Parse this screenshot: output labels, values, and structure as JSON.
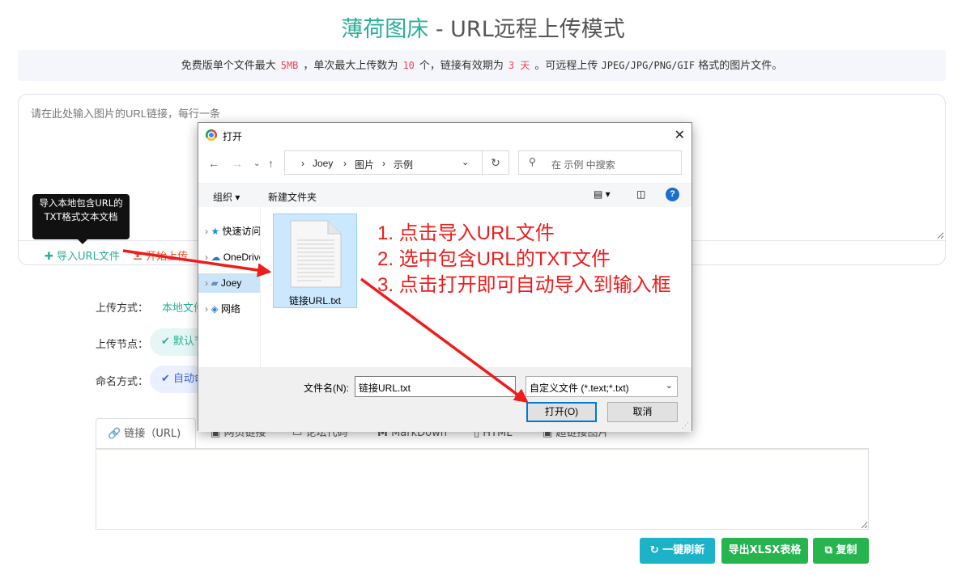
{
  "header": {
    "brand": "薄荷图床",
    "separator": " - ",
    "subtitle": "URL远程上传模式"
  },
  "notice": {
    "part1": "免费版单个文件最大",
    "max_size": "5MB",
    "part2": "，单次最大上传数为",
    "max_count": "10",
    "part3": "个，链接有效期为",
    "expire": "3 天",
    "part4": "。可远程上传",
    "formats": "JPEG/JPG/PNG/GIF",
    "part5": "格式的图片文件。"
  },
  "url_input": {
    "placeholder": "请在此处输入图片的URL链接，每行一条",
    "value": ""
  },
  "toolbar": {
    "import_label": "导入URL文件",
    "upload_label": "开始上传",
    "tooltip": "导入本地包含URL的TXT格式文本文档"
  },
  "settings": {
    "mode_label": "上传方式：",
    "mode_value": "本地文件",
    "node_label": "上传节点：",
    "node_value": "默认节点",
    "naming_label": "命名方式：",
    "naming_value": "自动命名"
  },
  "tabs": [
    {
      "label": "链接（URL)",
      "icon": "link-icon"
    },
    {
      "label": "网页链接",
      "icon": "image-icon"
    },
    {
      "label": "论坛代码",
      "icon": "chat-icon"
    },
    {
      "label": "MarkDown",
      "icon": "markdown-icon"
    },
    {
      "label": "HTML",
      "icon": "html-icon"
    },
    {
      "label": "超链接图片",
      "icon": "image-icon"
    }
  ],
  "result": {
    "value": ""
  },
  "actions": {
    "refresh": "一键刷新",
    "export": "导出XLSX表格",
    "copy": "复制"
  },
  "dialog": {
    "title": "打开",
    "breadcrumb": [
      "Joey",
      "图片",
      "示例"
    ],
    "search_placeholder": "在 示例 中搜索",
    "organize": "组织",
    "new_folder": "新建文件夹",
    "tree": [
      "快速访问",
      "OneDrive",
      "Joey",
      "网络"
    ],
    "file_name": "链接URL.txt",
    "filename_label": "文件名(N):",
    "filename_value": "链接URL.txt",
    "filetype": "自定义文件 (*.text;*.txt)",
    "open_button": "打开(O)",
    "cancel_button": "取消"
  },
  "annotations": [
    "1. 点击导入URL文件",
    "2. 选中包含URL的TXT文件",
    "3. 点击打开即可自动导入到输入框"
  ],
  "colors": {
    "brand": "#2bb09a",
    "highlight": "#f0464f",
    "annotation": "#ef1c1c",
    "refresh_button": "#1cb2c7",
    "export_button": "#26b44e"
  }
}
